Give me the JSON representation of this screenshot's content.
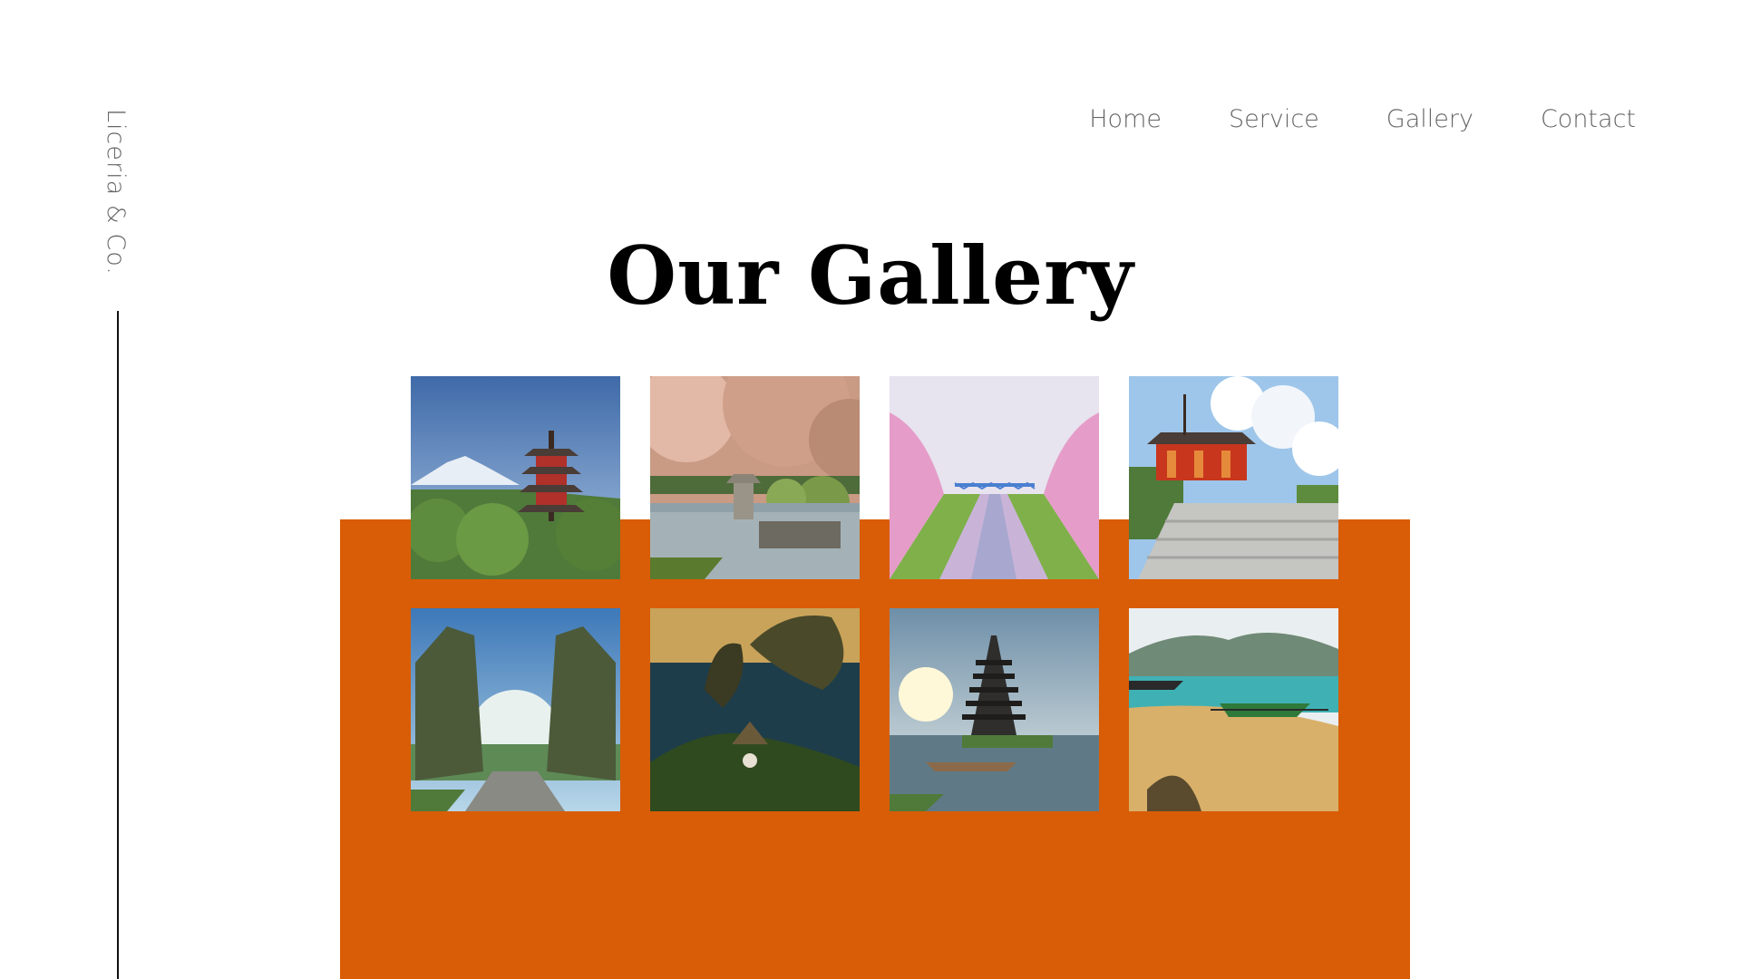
{
  "brand": {
    "name": "Liceria & Co."
  },
  "nav": {
    "items": [
      "Home",
      "Service",
      "Gallery",
      "Contact"
    ]
  },
  "page": {
    "title": "Our Gallery"
  },
  "colors": {
    "accent": "#D95D06",
    "nav_text": "#666666",
    "title": "#000000"
  },
  "gallery": {
    "photos": [
      {
        "icon": "pagoda-mount-fuji-photo"
      },
      {
        "icon": "cherry-blossom-garden-pond-photo"
      },
      {
        "icon": "cherry-blossom-river-bridge-photo"
      },
      {
        "icon": "red-temple-stairs-photo"
      },
      {
        "icon": "bali-split-gate-photo"
      },
      {
        "icon": "coastal-cliffs-photo"
      },
      {
        "icon": "lake-water-temple-photo"
      },
      {
        "icon": "beach-boat-photo"
      }
    ]
  }
}
